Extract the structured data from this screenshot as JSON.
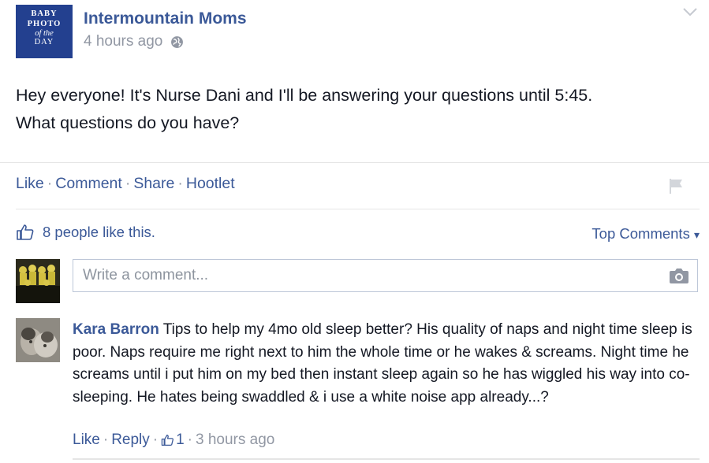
{
  "post": {
    "page_avatar": {
      "line1": "BABY",
      "line2": "PHOTO",
      "line3": "of the",
      "line4": "DAY"
    },
    "page_name": "Intermountain Moms",
    "timestamp": "4 hours ago",
    "privacy_icon": "globe-icon",
    "options_icon": "chevron-down-icon",
    "text_line1": "Hey everyone! It's Nurse Dani and I'll be answering your questions until 5:45.",
    "text_line2": "What questions do you have?"
  },
  "actions": {
    "like": "Like",
    "comment": "Comment",
    "share": "Share",
    "hootlet": "Hootlet",
    "separator": "·",
    "flag_icon": "flag-icon"
  },
  "likes": {
    "icon": "thumbs-up-icon",
    "text": "8 people like this.",
    "sort_label": "Top Comments",
    "sort_caret": "▾"
  },
  "composer": {
    "placeholder": "Write a comment...",
    "camera_icon": "camera-icon"
  },
  "comments": [
    {
      "author": "Kara Barron",
      "text": "Tips to help my 4mo old sleep better? His quality of naps and night time sleep is poor. Naps require me right next to him the whole time or he wakes & screams. Night time he screams until i put him on my bed then instant sleep again so he has wiggled his way into co-sleeping. He hates being swaddled & i use a white noise app already...?",
      "like_label": "Like",
      "reply_label": "Reply",
      "like_count": "1",
      "time": "3 hours ago"
    }
  ],
  "colors": {
    "link": "#3b5998",
    "muted": "#9197a3",
    "page_avatar_bg": "#23408f",
    "text": "#141823"
  }
}
